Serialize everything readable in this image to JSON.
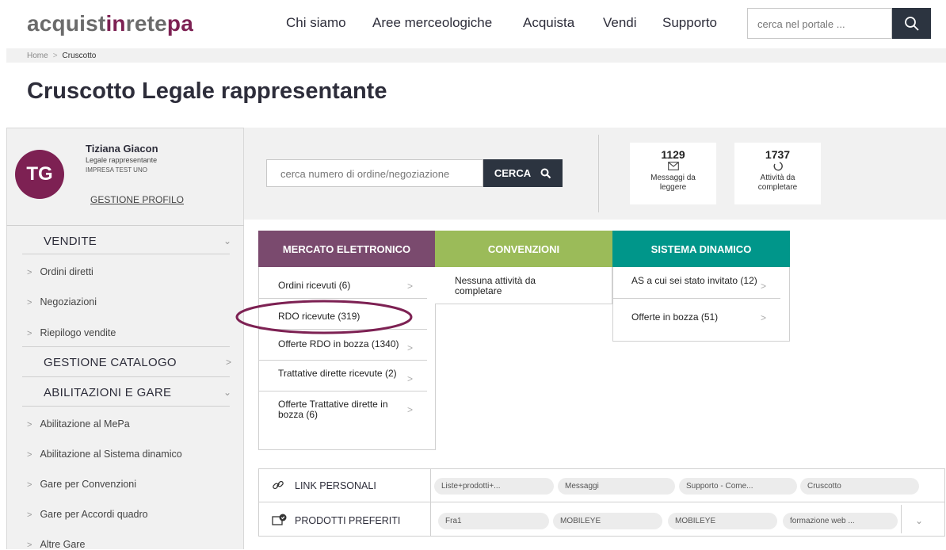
{
  "header": {
    "logo_a": "acquist",
    "logo_b": "in",
    "logo_c": "rete",
    "logo_d": "pa",
    "nav": [
      "Chi siamo",
      "Aree merceologiche",
      "Acquista",
      "Vendi",
      "Supporto"
    ],
    "search_placeholder": "cerca nel portale ..."
  },
  "breadcrumb": {
    "home": "Home",
    "separator": ">",
    "current": "Cruscotto"
  },
  "page_title": "Cruscotto Legale rappresentante",
  "user": {
    "initials": "TG",
    "name": "Tiziana Giacon",
    "role": "Legale rappresentante",
    "company": "IMPRESA TEST UNO",
    "profile_link": "GESTIONE PROFILO"
  },
  "sidebar": {
    "vendite": "VENDITE",
    "vendite_items": [
      "Ordini diretti",
      "Negoziazioni",
      "Riepilogo vendite"
    ],
    "catalogo": "GESTIONE CATALOGO",
    "abilitazioni": "ABILITAZIONI E GARE",
    "abilitazioni_items": [
      "Abilitazione al MePa",
      "Abilitazione al Sistema dinamico",
      "Gare per Convenzioni",
      "Gare per Accordi quadro",
      "Altre Gare"
    ]
  },
  "order_search": {
    "placeholder": "cerca numero di ordine/negoziazione",
    "button": "CERCA"
  },
  "stats": {
    "messages_count": "1129",
    "messages_label_1": "Messaggi da",
    "messages_label_2": "leggere",
    "activities_count": "1737",
    "activities_label_1": "Attività da",
    "activities_label_2": "completare"
  },
  "tabs": {
    "mercato": "MERCATO ELETTRONICO",
    "convenzioni": "CONVENZIONI",
    "sistema": "SISTEMA DINAMICO",
    "colors": {
      "mercato": "#7a4a6e",
      "convenzioni": "#9bbb59",
      "sistema": "#00968a"
    }
  },
  "mercato_items": [
    "Ordini ricevuti (6)",
    "RDO ricevute (319)",
    "Offerte RDO in bozza (1340)",
    "Trattative dirette ricevute (2)",
    "Offerte Trattative dirette in bozza (6)"
  ],
  "convenzioni_items": [
    "Nessuna attività da completare"
  ],
  "sistema_items": [
    "AS a cui sei stato invitato (12)",
    "Offerte in bozza (51)"
  ],
  "links": {
    "label": "LINK PERSONALI",
    "items": [
      "Liste+prodotti+...",
      "Messaggi",
      "Supporto - Come...",
      "Cruscotto"
    ]
  },
  "favorites": {
    "label": "PRODOTTI PREFERITI",
    "items": [
      "Fra1",
      "MOBILEYE",
      "MOBILEYE",
      "formazione web ..."
    ]
  }
}
